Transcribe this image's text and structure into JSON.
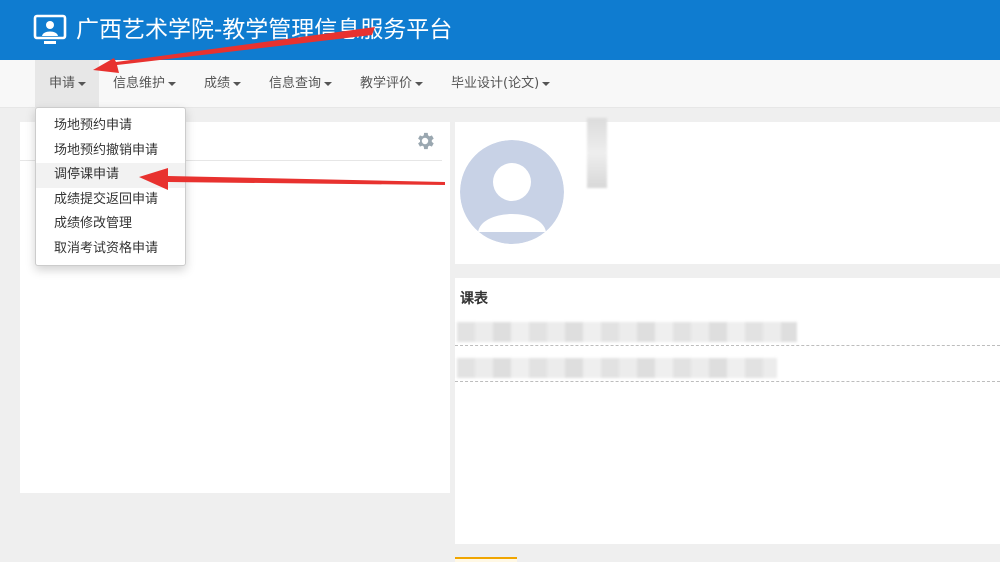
{
  "header": {
    "title": "广西艺术学院-教学管理信息服务平台",
    "logo_icon": "monitor-user-icon",
    "background": "#0f7cd0"
  },
  "nav": {
    "items": [
      {
        "label": "申请"
      },
      {
        "label": "信息维护"
      },
      {
        "label": "成绩"
      },
      {
        "label": "信息查询"
      },
      {
        "label": "教学评价"
      },
      {
        "label": "毕业设计(论文)"
      }
    ]
  },
  "dropdown": {
    "items": [
      {
        "label": "场地预约申请"
      },
      {
        "label": "场地预约撤销申请"
      },
      {
        "label": "调停课申请"
      },
      {
        "label": "成绩提交返回申请"
      },
      {
        "label": "成绩修改管理"
      },
      {
        "label": "取消考试资格申请"
      }
    ],
    "highlighted_index": 2
  },
  "left_panel": {
    "settings_icon": "gear-icon"
  },
  "profile": {
    "avatar_icon": "default-avatar-icon"
  },
  "schedule": {
    "title": "课表"
  },
  "annotation": {
    "arrow_color": "#e8322f"
  }
}
